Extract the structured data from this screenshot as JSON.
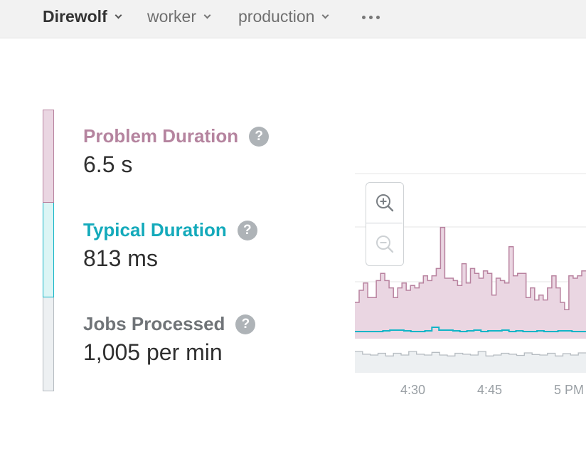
{
  "breadcrumb": {
    "app": "Direwolf",
    "environment": "worker",
    "stage": "production"
  },
  "metrics": {
    "problem": {
      "label": "Problem Duration",
      "value": "6.5 s"
    },
    "typical": {
      "label": "Typical Duration",
      "value": "813 ms"
    },
    "jobs": {
      "label": "Jobs Processed",
      "value": "1,005 per min"
    },
    "help_glyph": "?"
  },
  "colors": {
    "problem": "#b8829f",
    "problem_fill": "#ead6e2",
    "typical": "#12b5c7",
    "jobs": "#b6bcc1",
    "jobs_fill": "#edf0f2"
  },
  "icons": {
    "zoom_in": "zoom-in-icon",
    "zoom_out": "zoom-out-icon",
    "help": "question-icon",
    "more": "more-horizontal-icon"
  },
  "chart_data": {
    "type": "area",
    "x_ticks": [
      "4:30",
      "4:45",
      "5 PM"
    ],
    "series": [
      {
        "name": "Problem Duration",
        "values": [
          1.5,
          2.0,
          2.3,
          1.7,
          1.7,
          2.4,
          2.7,
          2.4,
          2.1,
          1.7,
          2.1,
          2.3,
          2.0,
          2.2,
          2.1,
          2.3,
          2.6,
          2.4,
          2.6,
          2.9,
          4.6,
          2.5,
          2.5,
          2.4,
          2.2,
          3.1,
          2.3,
          2.9,
          2.7,
          2.5,
          2.8,
          2.7,
          1.8,
          2.5,
          2.4,
          2.3,
          3.8,
          2.6,
          2.7,
          2.7,
          1.7,
          2.1,
          1.6,
          1.8,
          1.6,
          2.1,
          2.6,
          2.1,
          1.5,
          1.2,
          2.6,
          2.5,
          2.6,
          2.8
        ]
      },
      {
        "name": "Typical Duration",
        "values": [
          0.5,
          0.5,
          0.5,
          0.5,
          0.55,
          0.6,
          0.6,
          0.55,
          0.5,
          0.5,
          0.55,
          0.8,
          0.6,
          0.6,
          0.55,
          0.5,
          0.55,
          0.6,
          0.5,
          0.55,
          0.55,
          0.6,
          0.5,
          0.55,
          0.5,
          0.5,
          0.55,
          0.5,
          0.5,
          0.55,
          0.55,
          0.5,
          0.5
        ]
      },
      {
        "name": "Jobs Processed",
        "values": [
          1020,
          1005,
          1000,
          1010,
          995,
          1010,
          1000,
          1020,
          1005,
          1000,
          1015,
          1000,
          995,
          1010,
          1005,
          1000,
          1020,
          995,
          1000,
          1010,
          1005,
          998,
          1012,
          1003,
          1000,
          1010,
          995,
          1008,
          1000,
          1012
        ]
      }
    ]
  }
}
